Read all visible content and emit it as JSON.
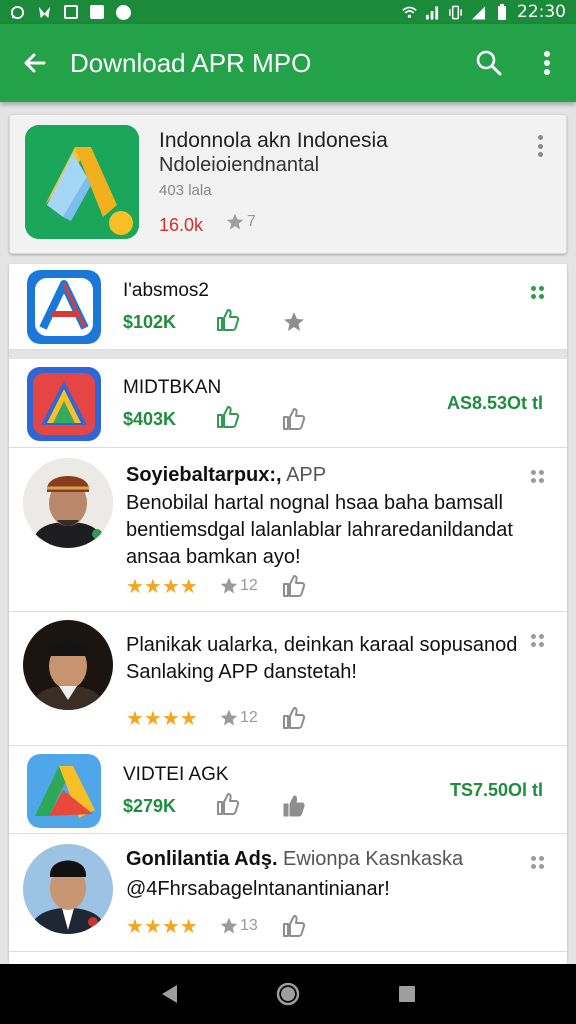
{
  "status_bar": {
    "time": "22:30",
    "left_icons": [
      "whatsapp-icon",
      "bird-icon",
      "square-icon",
      "photo-icon",
      "circle-icon"
    ],
    "right_icons": [
      "wifi-icon",
      "signal-icon",
      "vibrate-icon",
      "signal-icon",
      "battery-icon"
    ]
  },
  "app_bar": {
    "title": "Download APR MPO",
    "color": "#24a24a"
  },
  "featured": {
    "title": "Indonnola akn Indonesia",
    "subtitle": "Ndoleioiendnantal",
    "meta": "403 lala",
    "downloads": "16.0k",
    "rating": "7"
  },
  "apps": [
    {
      "name": "I'absmos2",
      "price": "$102K",
      "right_price": ""
    },
    {
      "name": "MIDTBKAN",
      "price": "$403K",
      "right_price": "AS8.53Ot tl"
    },
    {
      "name": "VIDTEI AGK",
      "price": "$279K",
      "right_price": "TS7.50Ol tl"
    }
  ],
  "reviews": [
    {
      "title_bold": "Soyiebaltarpux:,",
      "title_rest": " APP",
      "lines": [
        "Benobilal hartal nognal hsaa baha bamsall",
        "bentiemsdgal lalanlablar lahraredanildandat",
        "ansaa bamkan ayo!"
      ],
      "stars": "★★★★",
      "rating": "12"
    },
    {
      "title_bold": "",
      "title_rest": "",
      "lines": [
        "Planikak ualarka, deinkan karaal sopusanod",
        "Sanlaking APP danstetah!"
      ],
      "stars": "★★★★",
      "rating": "12"
    },
    {
      "title_bold": "Gonlilantia Adş.",
      "title_rest": " Ewionpa Kasnkaska",
      "lines": [
        "@4Fhrsabagelntanantinianar!"
      ],
      "stars": "★★★★",
      "rating": "13"
    }
  ],
  "nav": {
    "back": "back-triangle-icon",
    "home": "home-circle-icon",
    "recents": "recents-square-icon"
  },
  "colors": {
    "accent_green": "#24a24a",
    "price_green": "#1e8e3e",
    "download_red": "#d32f2f",
    "star_gold": "#f4a621"
  }
}
